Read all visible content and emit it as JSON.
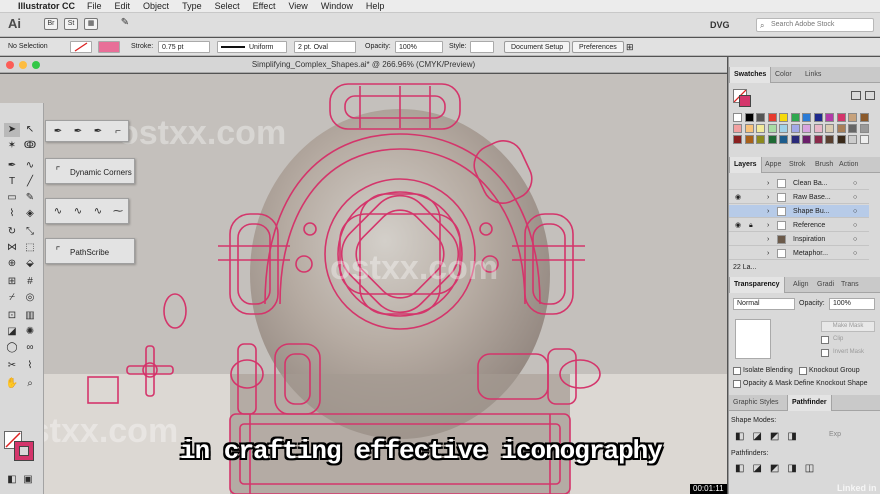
{
  "menubar": {
    "app": "Illustrator CC",
    "items": [
      "File",
      "Edit",
      "Object",
      "Type",
      "Select",
      "Effect",
      "View",
      "Window",
      "Help"
    ]
  },
  "appbar": {
    "logo": "Ai",
    "workspace": "DVG",
    "stock_placeholder": "Search Adobe Stock"
  },
  "controlbar": {
    "selection": "No Selection",
    "stroke_label": "Stroke:",
    "stroke_value": "0.75 pt",
    "profile": "Uniform",
    "brush": "2 pt. Oval",
    "opacity_label": "Opacity:",
    "opacity_value": "100%",
    "style_label": "Style:",
    "document_setup": "Document Setup",
    "preferences": "Preferences"
  },
  "document": {
    "title": "Simplifying_Complex_Shapes.ai* @ 266.96% (CMYK/Preview)"
  },
  "flyouts": {
    "dynamic_corners": "Dynamic Corners",
    "pathscribe": "PathScribe"
  },
  "panels": {
    "swatches_tabs": [
      "Swatches",
      "Color",
      "Links"
    ],
    "layers_tabs": [
      "Layers",
      "Appe",
      "Strok",
      "Brush",
      "Action"
    ],
    "layers": [
      {
        "name": "Clean Ba...",
        "visible": false,
        "locked": false,
        "selected": false
      },
      {
        "name": "Raw Base...",
        "visible": true,
        "locked": false,
        "selected": false
      },
      {
        "name": "Shape Bu...",
        "visible": false,
        "locked": false,
        "selected": true
      },
      {
        "name": "Reference",
        "visible": true,
        "locked": true,
        "selected": false
      },
      {
        "name": "Inspiration",
        "visible": false,
        "locked": false,
        "selected": false
      },
      {
        "name": "Metaphor...",
        "visible": false,
        "locked": false,
        "selected": false
      }
    ],
    "layers_count": "22 La...",
    "transparency_tabs": [
      "Transparency",
      "Align",
      "Gradi",
      "Trans"
    ],
    "blend_mode": "Normal",
    "opacity_label": "Opacity:",
    "opacity_value": "100%",
    "make_mask": "Make Mask",
    "clip": "Clip",
    "invert_mask": "Invert Mask",
    "isolate_blending": "Isolate Blending",
    "knockout_group": "Knockout Group",
    "opacity_mask_knockout": "Opacity & Mask Define Knockout Shape",
    "pathfinder_tabs": [
      "Graphic Styles",
      "Pathfinder"
    ],
    "shape_modes": "Shape Modes:",
    "pathfinders": "Pathfinders:"
  },
  "video": {
    "subtitle": "in crafting effective iconography",
    "timecode": "00:01:11",
    "brand": "Linked in",
    "watermark": "ostxx.com"
  },
  "colors": {
    "accent_path": "#d4356b",
    "selected_layer": "#b7cbe8"
  }
}
